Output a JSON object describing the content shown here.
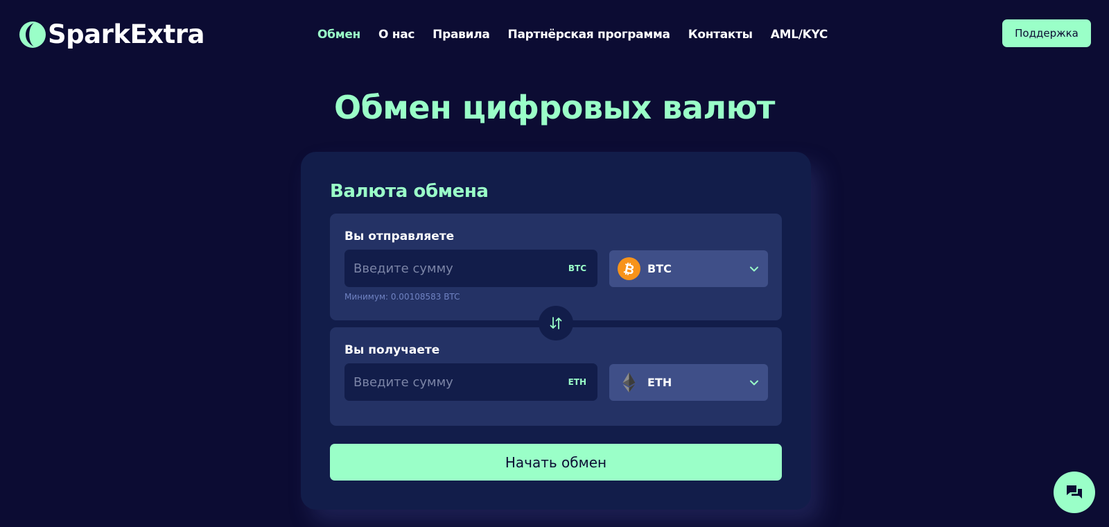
{
  "brand": {
    "name": "SparkExtra",
    "accent_color": "#9affc8",
    "background_color": "#0c0c33"
  },
  "nav": {
    "items": [
      {
        "label": "Обмен",
        "active": true
      },
      {
        "label": "О нас",
        "active": false
      },
      {
        "label": "Правила",
        "active": false
      },
      {
        "label": "Партнёрская программа",
        "active": false
      },
      {
        "label": "Контакты",
        "active": false
      },
      {
        "label": "AML/KYC",
        "active": false
      }
    ],
    "support_label": "Поддержка"
  },
  "page": {
    "title": "Обмен цифровых валют"
  },
  "exchange": {
    "title": "Валюта обмена",
    "send": {
      "label": "Вы отправляете",
      "amount_value": "",
      "amount_placeholder": "Введите сумму",
      "unit": "BTC",
      "currency": "BTC",
      "currency_icon": "bitcoin-icon",
      "minimum_note": "Минимум: 0.00108583 BTC"
    },
    "receive": {
      "label": "Вы получаете",
      "amount_value": "",
      "amount_placeholder": "Введите сумму",
      "unit": "ETH",
      "currency": "ETH",
      "currency_icon": "ethereum-icon"
    },
    "swap_icon": "swap-arrows-icon",
    "start_label": "Начать обмен"
  },
  "chat": {
    "icon": "chat-icon"
  }
}
